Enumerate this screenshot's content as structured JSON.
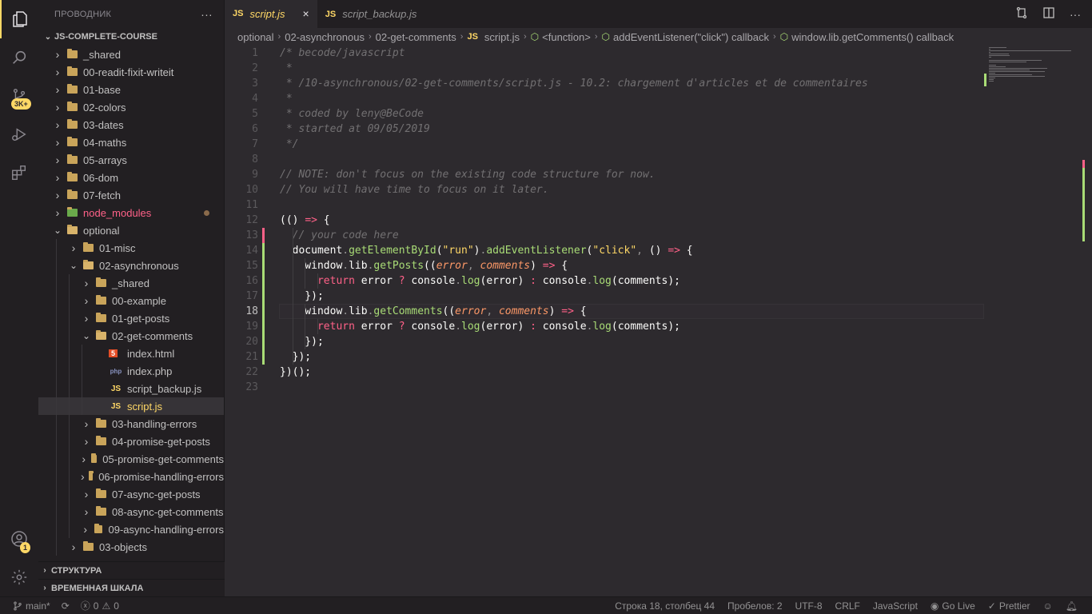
{
  "activity": {
    "badge_scm": "3K+",
    "badge_accounts": "1"
  },
  "explorer": {
    "title": "ПРОВОДНИК",
    "more": "···",
    "root": "JS-COMPLETE-COURSE",
    "items": [
      {
        "label": "_shared",
        "depth": 1,
        "type": "folder",
        "open": false
      },
      {
        "label": "00-readit-fixit-writeit",
        "depth": 1,
        "type": "folder",
        "open": false
      },
      {
        "label": "01-base",
        "depth": 1,
        "type": "folder",
        "open": false
      },
      {
        "label": "02-colors",
        "depth": 1,
        "type": "folder",
        "open": false
      },
      {
        "label": "03-dates",
        "depth": 1,
        "type": "folder",
        "open": false
      },
      {
        "label": "04-maths",
        "depth": 1,
        "type": "folder",
        "open": false
      },
      {
        "label": "05-arrays",
        "depth": 1,
        "type": "folder",
        "open": false
      },
      {
        "label": "06-dom",
        "depth": 1,
        "type": "folder",
        "open": false
      },
      {
        "label": "07-fetch",
        "depth": 1,
        "type": "folder",
        "open": false
      },
      {
        "label": "node_modules",
        "depth": 1,
        "type": "node",
        "open": false,
        "color": "#ff6188",
        "modified": true
      },
      {
        "label": "optional",
        "depth": 1,
        "type": "folder",
        "open": true
      },
      {
        "label": "01-misc",
        "depth": 2,
        "type": "folder",
        "open": false
      },
      {
        "label": "02-asynchronous",
        "depth": 2,
        "type": "folder",
        "open": true
      },
      {
        "label": "_shared",
        "depth": 3,
        "type": "folder",
        "open": false
      },
      {
        "label": "00-example",
        "depth": 3,
        "type": "folder",
        "open": false
      },
      {
        "label": "01-get-posts",
        "depth": 3,
        "type": "folder",
        "open": false
      },
      {
        "label": "02-get-comments",
        "depth": 3,
        "type": "folder",
        "open": true
      },
      {
        "label": "index.html",
        "depth": 4,
        "type": "html"
      },
      {
        "label": "index.php",
        "depth": 4,
        "type": "php"
      },
      {
        "label": "script_backup.js",
        "depth": 4,
        "type": "js"
      },
      {
        "label": "script.js",
        "depth": 4,
        "type": "js",
        "selected": true
      },
      {
        "label": "03-handling-errors",
        "depth": 3,
        "type": "folder",
        "open": false
      },
      {
        "label": "04-promise-get-posts",
        "depth": 3,
        "type": "folder",
        "open": false
      },
      {
        "label": "05-promise-get-comments",
        "depth": 3,
        "type": "folder",
        "open": false
      },
      {
        "label": "06-promise-handling-errors",
        "depth": 3,
        "type": "folder",
        "open": false
      },
      {
        "label": "07-async-get-posts",
        "depth": 3,
        "type": "folder",
        "open": false
      },
      {
        "label": "08-async-get-comments",
        "depth": 3,
        "type": "folder",
        "open": false
      },
      {
        "label": "09-async-handling-errors",
        "depth": 3,
        "type": "folder",
        "open": false
      },
      {
        "label": "03-objects",
        "depth": 2,
        "type": "folder",
        "open": false
      }
    ],
    "outline": "СТРУКТУРА",
    "timeline": "ВРЕМЕННАЯ ШКАЛА"
  },
  "tabs": [
    {
      "badge": "JS",
      "label": "script.js",
      "active": true,
      "close": "×"
    },
    {
      "badge": "JS",
      "label": "script_backup.js",
      "active": false
    }
  ],
  "breadcrumb": [
    "optional",
    "02-asynchronous",
    "02-get-comments",
    "script.js",
    "<function>",
    "addEventListener(\"click\") callback",
    "window.lib.getComments() callback"
  ],
  "breadcrumb_js": "JS",
  "editor": {
    "current_line": 18,
    "lines": [
      [
        [
          "c-cm",
          "/* becode/javascript"
        ]
      ],
      [
        [
          "c-cm",
          " *"
        ]
      ],
      [
        [
          "c-cm",
          " * /10-asynchronous/02-get-comments/script.js - 10.2: chargement d'articles et de commentaires"
        ]
      ],
      [
        [
          "c-cm",
          " *"
        ]
      ],
      [
        [
          "c-cm",
          " * coded by leny@BeCode"
        ]
      ],
      [
        [
          "c-cm",
          " * started at 09/05/2019"
        ]
      ],
      [
        [
          "c-cm",
          " */"
        ]
      ],
      [],
      [
        [
          "c-cm",
          "// NOTE: don't focus on the existing code structure for now."
        ]
      ],
      [
        [
          "c-cm",
          "// You will have time to focus on it later."
        ]
      ],
      [],
      [
        [
          "c-t",
          "(() "
        ],
        [
          "c-op",
          "=>"
        ],
        [
          "c-t",
          " {"
        ]
      ],
      [
        [
          "c-t",
          "  "
        ],
        [
          "c-cm",
          "// your code here"
        ]
      ],
      [
        [
          "c-t",
          "  document"
        ],
        [
          "c-p",
          "."
        ],
        [
          "c-fn",
          "getElementById"
        ],
        [
          "c-t",
          "("
        ],
        [
          "c-str",
          "\"run\""
        ],
        [
          "c-t",
          ")"
        ],
        [
          "c-p",
          "."
        ],
        [
          "c-fn",
          "addEventListener"
        ],
        [
          "c-t",
          "("
        ],
        [
          "c-str",
          "\"click\""
        ],
        [
          "c-p",
          ","
        ],
        [
          "c-t",
          " () "
        ],
        [
          "c-op",
          "=>"
        ],
        [
          "c-t",
          " {"
        ]
      ],
      [
        [
          "c-t",
          "    window"
        ],
        [
          "c-p",
          "."
        ],
        [
          "c-t",
          "lib"
        ],
        [
          "c-p",
          "."
        ],
        [
          "c-fn",
          "getPosts"
        ],
        [
          "c-t",
          "(("
        ],
        [
          "c-pr",
          "error"
        ],
        [
          "c-p",
          ","
        ],
        [
          "c-t",
          " "
        ],
        [
          "c-pr",
          "comments"
        ],
        [
          "c-t",
          ") "
        ],
        [
          "c-op",
          "=>"
        ],
        [
          "c-t",
          " {"
        ]
      ],
      [
        [
          "c-t",
          "      "
        ],
        [
          "c-kw",
          "return"
        ],
        [
          "c-t",
          " error "
        ],
        [
          "c-op",
          "?"
        ],
        [
          "c-t",
          " console"
        ],
        [
          "c-p",
          "."
        ],
        [
          "c-fn",
          "log"
        ],
        [
          "c-t",
          "(error) "
        ],
        [
          "c-op",
          ":"
        ],
        [
          "c-t",
          " console"
        ],
        [
          "c-p",
          "."
        ],
        [
          "c-fn",
          "log"
        ],
        [
          "c-t",
          "(comments);"
        ]
      ],
      [
        [
          "c-t",
          "    });"
        ]
      ],
      [
        [
          "c-t",
          "    window"
        ],
        [
          "c-p",
          "."
        ],
        [
          "c-t",
          "lib"
        ],
        [
          "c-p",
          "."
        ],
        [
          "c-fn",
          "getComments"
        ],
        [
          "c-t",
          "(("
        ],
        [
          "c-pr",
          "error"
        ],
        [
          "c-p",
          ","
        ],
        [
          "c-t",
          " "
        ],
        [
          "c-pr",
          "comments"
        ],
        [
          "c-t",
          ") "
        ],
        [
          "c-op",
          "=>"
        ],
        [
          "c-t",
          " {"
        ]
      ],
      [
        [
          "c-t",
          "      "
        ],
        [
          "c-kw",
          "return"
        ],
        [
          "c-t",
          " error "
        ],
        [
          "c-op",
          "?"
        ],
        [
          "c-t",
          " console"
        ],
        [
          "c-p",
          "."
        ],
        [
          "c-fn",
          "log"
        ],
        [
          "c-t",
          "(error) "
        ],
        [
          "c-op",
          ":"
        ],
        [
          "c-t",
          " console"
        ],
        [
          "c-p",
          "."
        ],
        [
          "c-fn",
          "log"
        ],
        [
          "c-t",
          "(comments);"
        ]
      ],
      [
        [
          "c-t",
          "    });"
        ]
      ],
      [
        [
          "c-t",
          "  });"
        ]
      ],
      [
        [
          "c-t",
          "})();"
        ]
      ],
      []
    ]
  },
  "status": {
    "branch": "main*",
    "errors": "0",
    "warnings": "0",
    "position": "Строка 18, столбец 44",
    "spaces": "Пробелов: 2",
    "encoding": "UTF-8",
    "eol": "CRLF",
    "language": "JavaScript",
    "golive": "Go Live",
    "prettier": "Prettier"
  },
  "colors": {
    "accent": "#ffd866",
    "added": "#a9dc76",
    "deleted": "#ff6188",
    "background": "#2d2a2e"
  }
}
